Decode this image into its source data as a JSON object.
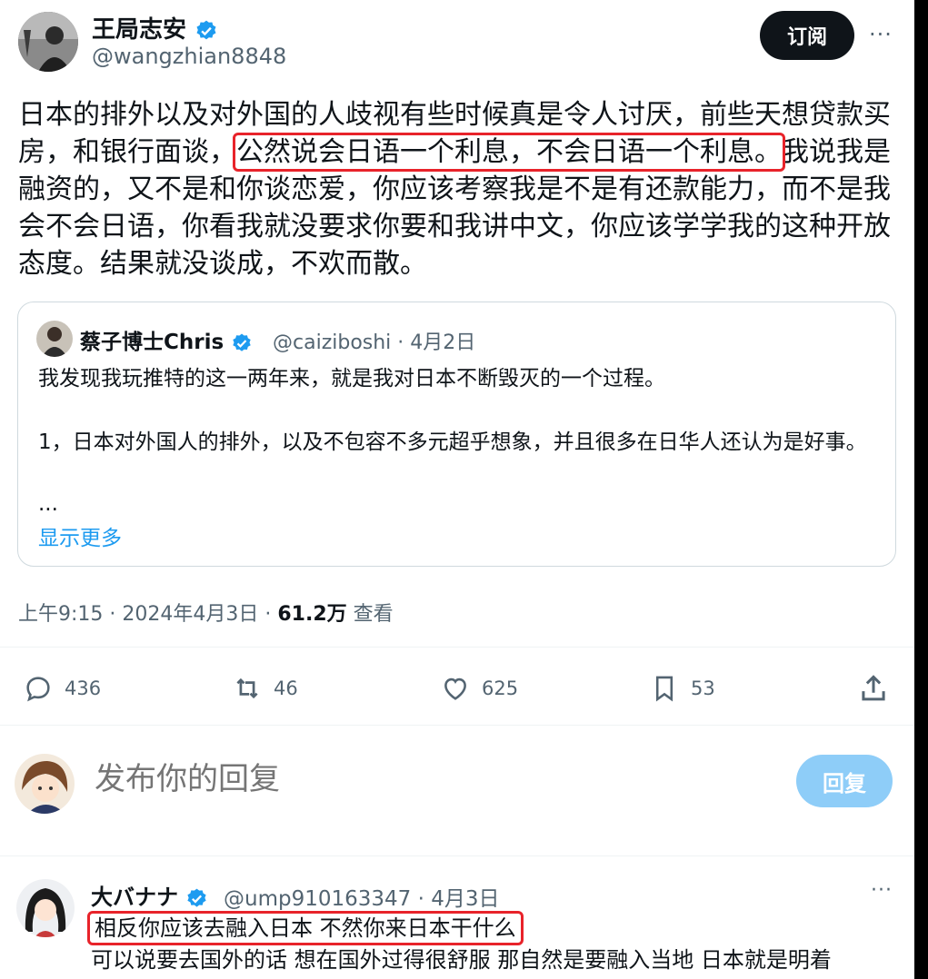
{
  "colors": {
    "accent": "#1d9bf0",
    "highlight": "#e8232a",
    "text": "#0f1419",
    "muted": "#536471"
  },
  "post": {
    "author_name": "王局志安",
    "author_handle": "@wangzhian8848",
    "subscribe_label": "订阅",
    "more_label": "···",
    "text_before": "日本的排外以及对外国的人歧视有些时候真是令人讨厌，前些天想贷款买房，和银行面谈，",
    "text_highlight": "公然说会日语一个利息，不会日语一个利息。",
    "text_after": "我说我是融资的，又不是和你谈恋爱，你应该考察我是不是有还款能力，而不是我会不会日语，你看我就没要求你要和我讲中文，你应该学学我的这种开放态度。结果就没谈成，不欢而散。",
    "time": "上午9:15 · 2024年4月3日 ·",
    "views_count": "61.2万",
    "views_label": "查看"
  },
  "quote": {
    "author_name": "蔡子博士Chris",
    "author_handle": "@caiziboshi · 4月2日",
    "line1": "我发现我玩推特的这一两年来，就是我对日本不断毁灭的一个过程。",
    "line2": "1，日本对外国人的排外，以及不包容不多元超乎想象，并且很多在日华人还认为是好事。",
    "ellipsis": "...",
    "show_more": "显示更多"
  },
  "actions": {
    "replies": "436",
    "retweets": "46",
    "likes": "625",
    "bookmarks": "53",
    "icons": [
      "reply-icon",
      "retweet-icon",
      "like-icon",
      "bookmark-icon",
      "share-icon"
    ]
  },
  "composer": {
    "placeholder": "发布你的回复",
    "reply_button": "回复"
  },
  "reply": {
    "author_name": "大バナナ",
    "author_handle": "@ump910163347 · 4月3日",
    "more_label": "···",
    "line1": "相反你应该去融入日本 不然你来日本干什么",
    "line2": "可以说要去国外的话 想在国外过得很舒服 那自然是要融入当地 日本就是明着"
  }
}
